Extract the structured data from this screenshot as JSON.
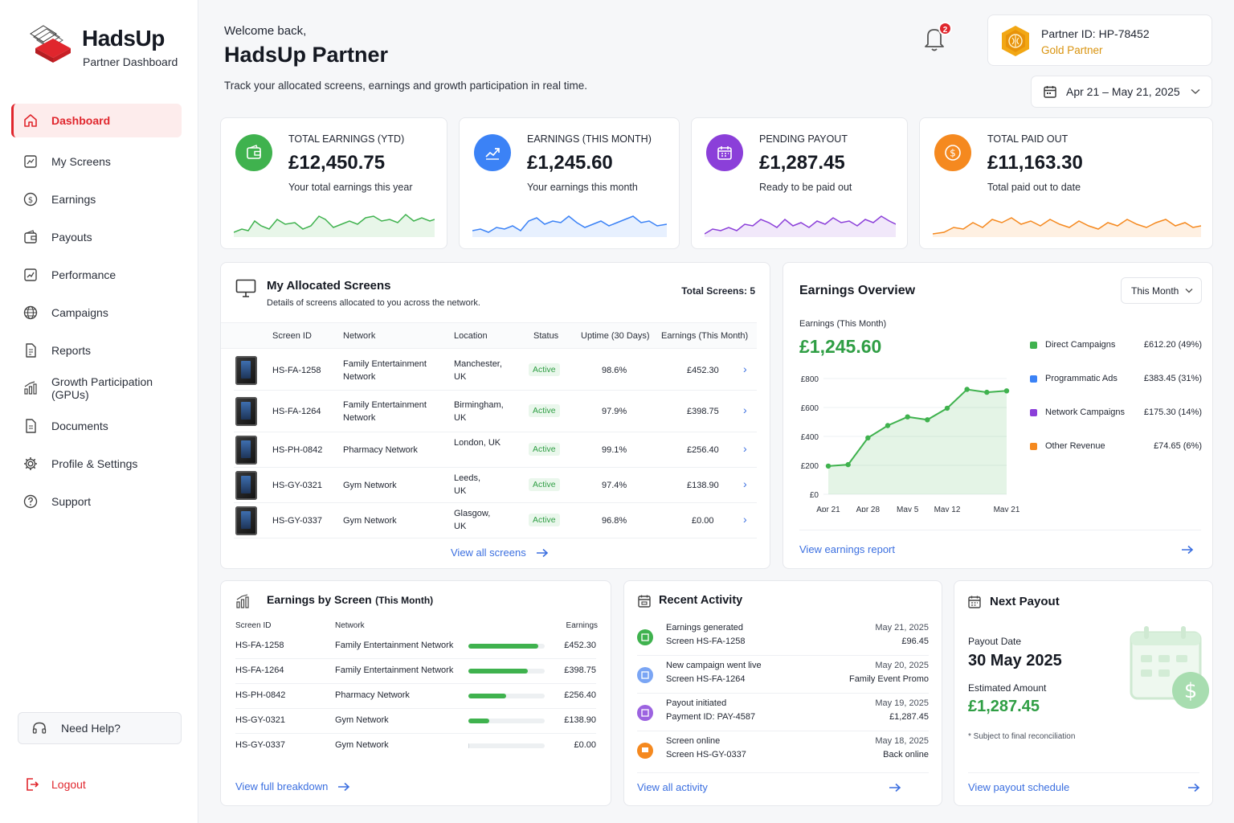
{
  "brand": {
    "name": "HadsUp",
    "subtitle": "Partner Dashboard"
  },
  "nav": {
    "items": [
      {
        "label": "Dashboard",
        "icon": "home-icon",
        "active": true
      },
      {
        "label": "My Screens",
        "icon": "screen-icon"
      },
      {
        "label": "Earnings",
        "icon": "dollar-icon"
      },
      {
        "label": "Payouts",
        "icon": "wallet-icon"
      },
      {
        "label": "Performance",
        "icon": "chart-icon"
      },
      {
        "label": "Campaigns",
        "icon": "globe-icon"
      },
      {
        "label": "Reports",
        "icon": "document-icon"
      },
      {
        "label": "Growth Participation (GPUs)",
        "icon": "growth-icon"
      },
      {
        "label": "Documents",
        "icon": "file-icon"
      },
      {
        "label": "Profile & Settings",
        "icon": "gear-icon"
      },
      {
        "label": "Support",
        "icon": "help-icon"
      }
    ],
    "help_label": "Need Help?",
    "logout_label": "Logout"
  },
  "header": {
    "welcome": "Welcome back,",
    "title": "HadsUp Partner",
    "subtitle": "Track your allocated screens, earnings and growth participation in real time.",
    "notification_count": "2",
    "partner_id": "Partner ID: HP-78452",
    "partner_tier": "Gold Partner",
    "date_range": "Apr 21 – May 21, 2025"
  },
  "stats": [
    {
      "label": "TOTAL EARNINGS (YTD)",
      "value": "£12,450.75",
      "desc": "Your total earnings this year",
      "color": "#3fb24e"
    },
    {
      "label": "EARNINGS (THIS MONTH)",
      "value": "£1,245.60",
      "desc": "Your earnings this month",
      "color": "#3b82f6"
    },
    {
      "label": "PENDING PAYOUT",
      "value": "£1,287.45",
      "desc": "Ready to be paid out",
      "color": "#8b3fd9"
    },
    {
      "label": "TOTAL PAID OUT",
      "value": "£11,163.30",
      "desc": "Total paid out to date",
      "color": "#f5891f"
    }
  ],
  "screens": {
    "title": "My Allocated Screens",
    "subtitle": "Details of screens allocated to you across the network.",
    "total": "Total Screens: 5",
    "columns": [
      "Screen ID",
      "Network",
      "Location",
      "Status",
      "Uptime (30 Days)",
      "Earnings (This Month)"
    ],
    "rows": [
      {
        "id": "HS-FA-1258",
        "network": "Family Entertainment Network",
        "location": "Manchester, UK",
        "status": "Active",
        "uptime": "98.6%",
        "earnings": "£452.30"
      },
      {
        "id": "HS-FA-1264",
        "network": "Family Entertainment Network",
        "location": "Birmingham, UK",
        "status": "Active",
        "uptime": "97.9%",
        "earnings": "£398.75"
      },
      {
        "id": "HS-PH-0842",
        "network": "Pharmacy Network",
        "location": "London, UK",
        "status": "Active",
        "uptime": "99.1%",
        "earnings": "£256.40"
      },
      {
        "id": "HS-GY-0321",
        "network": "Gym Network",
        "location": "Leeds, UK",
        "status": "Active",
        "uptime": "97.4%",
        "earnings": "£138.90"
      },
      {
        "id": "HS-GY-0337",
        "network": "Gym Network",
        "location": "Glasgow, UK",
        "status": "Active",
        "uptime": "96.8%",
        "earnings": "£0.00"
      }
    ],
    "view_all": "View all screens"
  },
  "overview": {
    "title": "Earnings Overview",
    "period": "This Month",
    "sub_label": "Earnings (This Month)",
    "value": "£1,245.60",
    "legend": [
      {
        "name": "Direct Campaigns",
        "value": "£612.20 (49%)",
        "color": "#3fb24e"
      },
      {
        "name": "Programmatic Ads",
        "value": "£383.45 (31%)",
        "color": "#3b82f6"
      },
      {
        "name": "Network Campaigns",
        "value": "£175.30 (14%)",
        "color": "#8b3fd9"
      },
      {
        "name": "Other Revenue",
        "value": "£74.65 (6%)",
        "color": "#f5891f"
      }
    ],
    "link": "View earnings report"
  },
  "chart_data": {
    "type": "area",
    "x": [
      "Apr 21",
      "Apr 24",
      "Apr 28",
      "May 1",
      "May 5",
      "May 8",
      "May 12",
      "May 15",
      "May 18",
      "May 21"
    ],
    "values": [
      195,
      205,
      390,
      475,
      535,
      515,
      595,
      725,
      705,
      715
    ],
    "xticks": [
      "Apr 21",
      "Apr 28",
      "May 5",
      "May 12",
      "May 21"
    ],
    "yticks": [
      "£0",
      "£200",
      "£400",
      "£600",
      "£800"
    ],
    "ylim": [
      0,
      800
    ],
    "color": "#3fb24e"
  },
  "by_screen": {
    "title": "Earnings by Screen",
    "title_suffix": "(This Month)",
    "columns": [
      "Screen ID",
      "Network",
      "Earnings"
    ],
    "rows": [
      {
        "id": "HS-FA-1258",
        "network": "Family Entertainment Network",
        "earnings": "£452.30",
        "share": 0.92
      },
      {
        "id": "HS-FA-1264",
        "network": "Family Entertainment Network",
        "earnings": "£398.75",
        "share": 0.78
      },
      {
        "id": "HS-PH-0842",
        "network": "Pharmacy Network",
        "earnings": "£256.40",
        "share": 0.49
      },
      {
        "id": "HS-GY-0321",
        "network": "Gym Network",
        "earnings": "£138.90",
        "share": 0.27
      },
      {
        "id": "HS-GY-0337",
        "network": "Gym Network",
        "earnings": "£0.00",
        "share": 0.01
      }
    ],
    "link": "View full breakdown"
  },
  "activity": {
    "title": "Recent Activity",
    "items": [
      {
        "title": "Earnings generated",
        "detail": "Screen HS-FA-1258",
        "date": "May 21, 2025",
        "meta": "£96.45",
        "color": "#3fb24e"
      },
      {
        "title": "New campaign went live",
        "detail": "Screen HS-FA-1264",
        "date": "May 20, 2025",
        "meta": "Family Event Promo",
        "color": "#3b82f6"
      },
      {
        "title": "Payout initiated",
        "detail": "Payment ID: PAY-4587",
        "date": "May 19, 2025",
        "meta": "£1,287.45",
        "color": "#8b3fd9"
      },
      {
        "title": "Screen online",
        "detail": "Screen HS-GY-0337",
        "date": "May 18, 2025",
        "meta": "Back online",
        "color": "#f5891f"
      }
    ],
    "link": "View all activity"
  },
  "payout": {
    "title": "Next Payout",
    "date_label": "Payout Date",
    "date": "30 May 2025",
    "amount_label": "Estimated Amount",
    "amount": "£1,287.45",
    "note": "* Subject to final reconciliation",
    "link": "View payout schedule"
  }
}
